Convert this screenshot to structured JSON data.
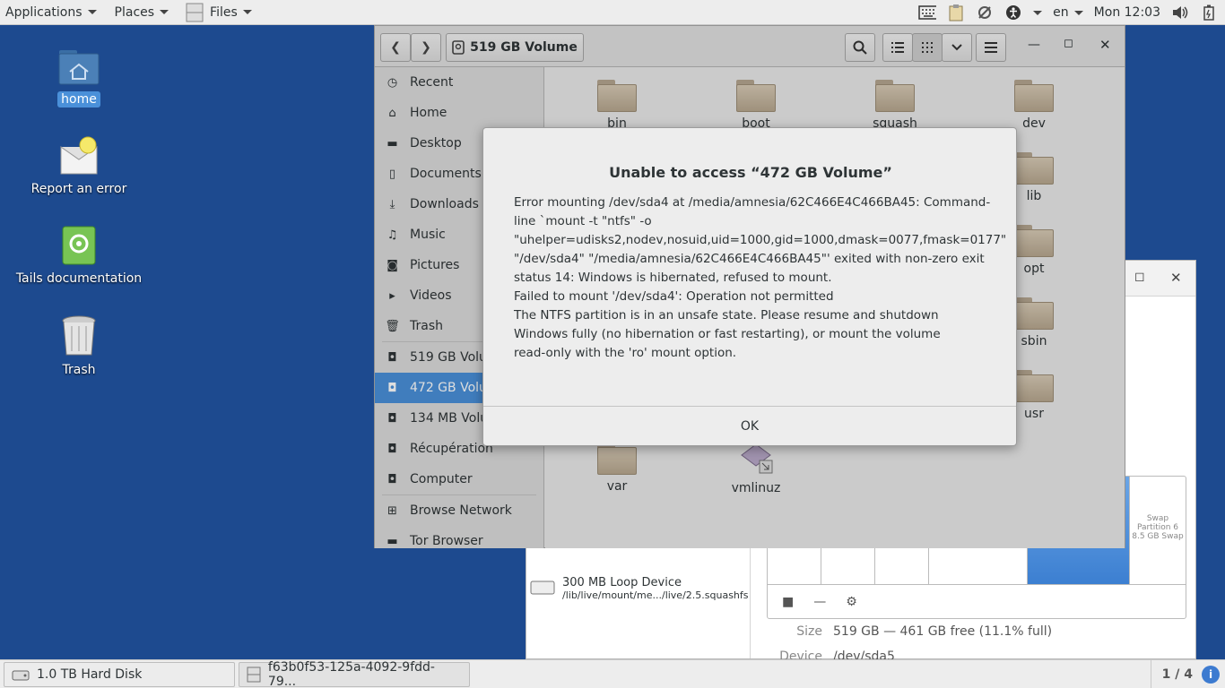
{
  "topbar": {
    "applications": "Applications",
    "places": "Places",
    "files": "Files",
    "language": "en",
    "clock": "Mon 12:03",
    "icons": [
      "keyboard-icon",
      "clipboard-icon",
      "network-icon",
      "accessibility-icon",
      "volume-icon",
      "battery-icon"
    ]
  },
  "desktop": {
    "icons": [
      {
        "label": "home",
        "icon": "home-folder-icon"
      },
      {
        "label": "Report an error",
        "icon": "report-error-icon"
      },
      {
        "label": "Tails documentation",
        "icon": "documentation-icon"
      },
      {
        "label": "Trash",
        "icon": "trash-icon"
      }
    ]
  },
  "files_window": {
    "location": "519 GB Volume",
    "sidebar": [
      {
        "label": "Recent",
        "icon": "clock-icon"
      },
      {
        "label": "Home",
        "icon": "home-icon"
      },
      {
        "label": "Desktop",
        "icon": "folder-icon"
      },
      {
        "label": "Documents",
        "icon": "document-icon"
      },
      {
        "label": "Downloads",
        "icon": "download-icon"
      },
      {
        "label": "Music",
        "icon": "music-icon"
      },
      {
        "label": "Pictures",
        "icon": "camera-icon"
      },
      {
        "label": "Videos",
        "icon": "video-icon"
      },
      {
        "label": "Trash",
        "icon": "trash-icon"
      },
      {
        "label": "519 GB Volu",
        "icon": "drive-icon"
      },
      {
        "label": "472 GB Volu",
        "icon": "drive-icon"
      },
      {
        "label": "134 MB Volu",
        "icon": "drive-icon"
      },
      {
        "label": "Récupération",
        "icon": "drive-icon"
      },
      {
        "label": "Computer",
        "icon": "drive-icon"
      },
      {
        "label": "Browse Network",
        "icon": "network-icon"
      },
      {
        "label": "Tor Browser",
        "icon": "folder-icon"
      }
    ],
    "folders": [
      "bin",
      "boot",
      "squash",
      "dev",
      "lib",
      "opt",
      "sbin",
      "usr",
      "var",
      "vmlinuz"
    ]
  },
  "dialog": {
    "title": "Unable to access “472 GB Volume”",
    "lines": [
      "Error mounting /dev/sda4 at /media/amnesia/62C466E4C466BA45: Command-",
      "line `mount -t \"ntfs\" -o",
      "\"uhelper=udisks2,nodev,nosuid,uid=1000,gid=1000,dmask=0077,fmask=0177\"",
      "\"/dev/sda4\" \"/media/amnesia/62C466E4C466BA45\"' exited with non-zero exit",
      "status 14: Windows is hibernated, refused to mount.",
      "Failed to mount '/dev/sda4': Operation not permitted",
      "The NTFS partition is in an unsafe state. Please resume and shutdown",
      "Windows fully (no hibernation or fast restarting), or mount the volume",
      "read-only with the 'ro' mount option."
    ],
    "ok_label": "OK"
  },
  "disks_window": {
    "device_name": "300 MB Loop Device",
    "device_path": "/lib/live/mount/me.../live/2.5.squashfs",
    "swap_label": "Swap\nPartition 6\n8.5 GB Swap",
    "size_key": "Size",
    "size_value": "519 GB — 461 GB free (11.1% full)",
    "device_key": "Device",
    "device_value": "/dev/sda5"
  },
  "taskbar": {
    "tasks": [
      "1.0 TB Hard Disk",
      "f63b0f53-125a-4092-9fdd-79..."
    ],
    "workspace": "1 / 4"
  }
}
